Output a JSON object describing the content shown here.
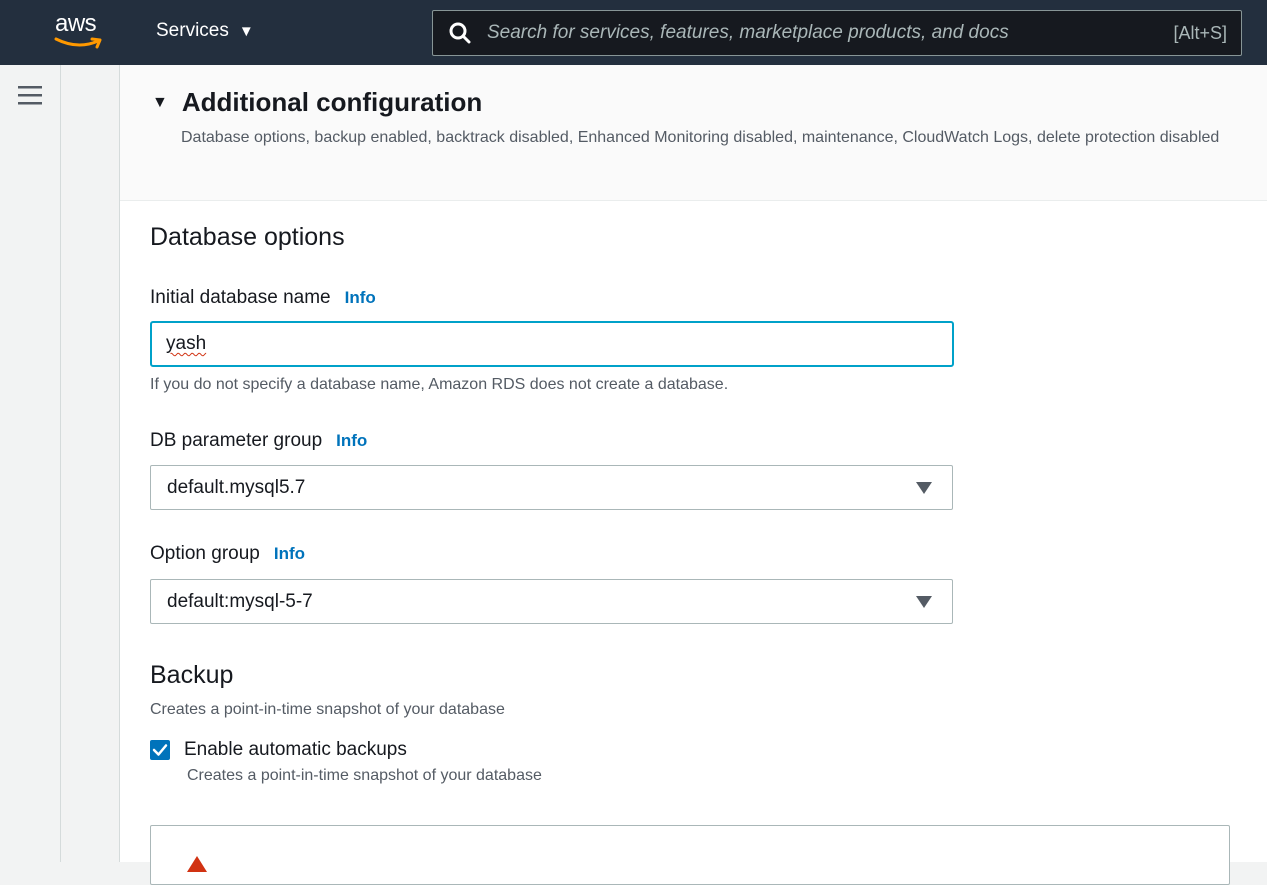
{
  "nav": {
    "logo_text": "aws",
    "services_label": "Services",
    "search_placeholder": "Search for services, features, marketplace products, and docs",
    "search_shortcut": "[Alt+S]"
  },
  "additional_config": {
    "title": "Additional configuration",
    "description": "Database options, backup enabled, backtrack disabled, Enhanced Monitoring disabled, maintenance, CloudWatch Logs, delete protection disabled"
  },
  "database_options": {
    "heading": "Database options",
    "initial_db_name": {
      "label": "Initial database name",
      "info": "Info",
      "value": "yash",
      "hint": "If you do not specify a database name, Amazon RDS does not create a database."
    },
    "db_parameter_group": {
      "label": "DB parameter group",
      "info": "Info",
      "value": "default.mysql5.7"
    },
    "option_group": {
      "label": "Option group",
      "info": "Info",
      "value": "default:mysql-5-7"
    }
  },
  "backup": {
    "heading": "Backup",
    "description": "Creates a point-in-time snapshot of your database",
    "enable_auto_backups": {
      "label": "Enable automatic backups",
      "description": "Creates a point-in-time snapshot of your database",
      "checked": true
    }
  },
  "colors": {
    "nav_bg": "#232f3e",
    "accent": "#0073bb",
    "focus_border": "#00a1c9",
    "warning": "#d13212"
  }
}
